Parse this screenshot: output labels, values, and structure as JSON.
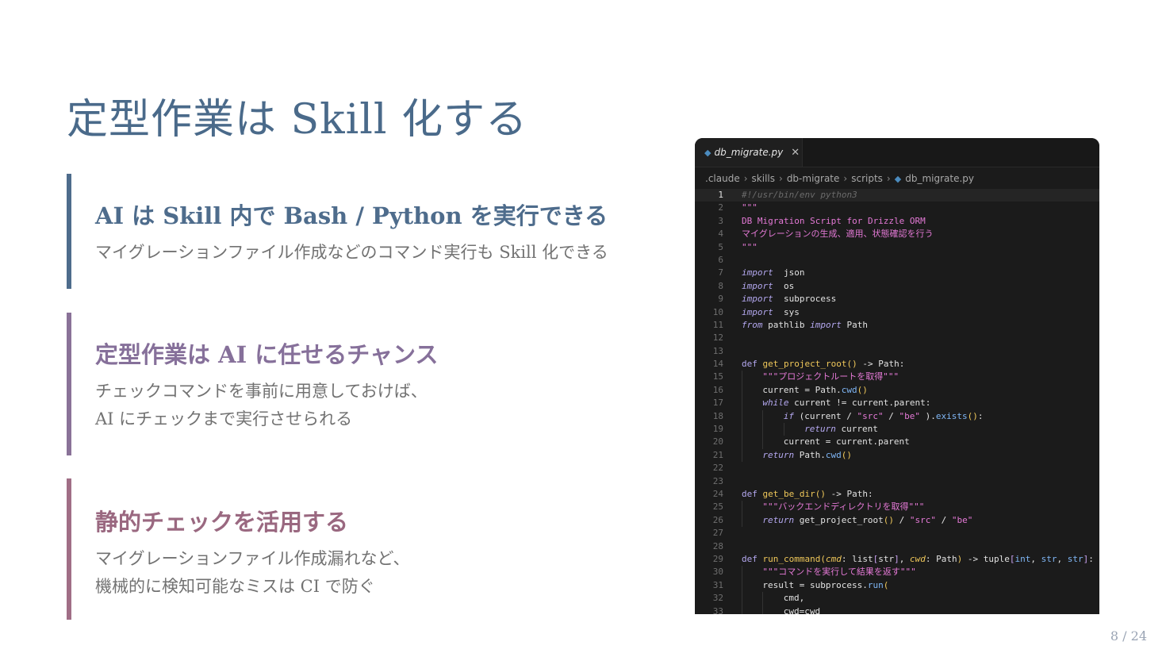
{
  "slide": {
    "title": "定型作業は Skill 化する",
    "points": [
      {
        "heading": "AI は Skill 内で Bash / Python を実行できる",
        "body": [
          "マイグレーションファイル作成などのコマンド実行も Skill 化できる"
        ]
      },
      {
        "heading": "定型作業は AI に任せるチャンス",
        "body": [
          "チェックコマンドを事前に用意しておけば、",
          "AI にチェックまで実行させられる"
        ]
      },
      {
        "heading": "静的チェックを活用する",
        "body": [
          "マイグレーションファイル作成漏れなど、",
          "機械的に検知可能なミスは CI で防ぐ"
        ]
      }
    ],
    "page_number": "8 / 24"
  },
  "editor": {
    "tab": {
      "filename": "db_migrate.py",
      "file_icon": "python-icon",
      "close_icon": "close-icon"
    },
    "breadcrumb": [
      ".claude",
      "skills",
      "db-migrate",
      "scripts",
      "db_migrate.py"
    ],
    "active_line": 1,
    "lines": [
      {
        "n": "1",
        "indent": 0,
        "parts": [
          [
            "c-com",
            "#!/usr/bin/env python3"
          ]
        ]
      },
      {
        "n": "2",
        "indent": 0,
        "parts": [
          [
            "c-str",
            "\"\"\""
          ]
        ]
      },
      {
        "n": "3",
        "indent": 0,
        "parts": [
          [
            "c-str",
            "DB Migration Script for Drizzle ORM"
          ]
        ]
      },
      {
        "n": "4",
        "indent": 0,
        "parts": [
          [
            "c-str",
            "マイグレーションの生成、適用、状態確認を行う"
          ]
        ]
      },
      {
        "n": "5",
        "indent": 0,
        "parts": [
          [
            "c-str",
            "\"\"\""
          ]
        ]
      },
      {
        "n": "6",
        "indent": 0,
        "parts": []
      },
      {
        "n": "7",
        "indent": 0,
        "parts": [
          [
            "c-kw",
            "import"
          ],
          [
            "",
            "  json"
          ]
        ]
      },
      {
        "n": "8",
        "indent": 0,
        "parts": [
          [
            "c-kw",
            "import"
          ],
          [
            "",
            "  os"
          ]
        ]
      },
      {
        "n": "9",
        "indent": 0,
        "parts": [
          [
            "c-kw",
            "import"
          ],
          [
            "",
            "  subprocess"
          ]
        ]
      },
      {
        "n": "10",
        "indent": 0,
        "parts": [
          [
            "c-kw",
            "import"
          ],
          [
            "",
            "  sys"
          ]
        ]
      },
      {
        "n": "11",
        "indent": 0,
        "parts": [
          [
            "c-kw",
            "from"
          ],
          [
            "",
            " pathlib "
          ],
          [
            "c-kw",
            "import"
          ],
          [
            "",
            " Path"
          ]
        ]
      },
      {
        "n": "12",
        "indent": 0,
        "parts": []
      },
      {
        "n": "13",
        "indent": 0,
        "parts": []
      },
      {
        "n": "14",
        "indent": 0,
        "parts": [
          [
            "c-def",
            "def "
          ],
          [
            "c-fn",
            "get_project_root"
          ],
          [
            "c-par",
            "()"
          ],
          [
            "",
            " -> Path:"
          ]
        ]
      },
      {
        "n": "15",
        "indent": 1,
        "parts": [
          [
            "c-str",
            "\"\"\"プロジェクトルートを取得\"\"\""
          ]
        ]
      },
      {
        "n": "16",
        "indent": 1,
        "parts": [
          [
            "",
            "current = Path."
          ],
          [
            "c-call",
            "cwd"
          ],
          [
            "c-par",
            "()"
          ]
        ]
      },
      {
        "n": "17",
        "indent": 1,
        "parts": [
          [
            "c-kw",
            "while"
          ],
          [
            "",
            " current != current.parent:"
          ]
        ]
      },
      {
        "n": "18",
        "indent": 2,
        "parts": [
          [
            "c-kw",
            "if"
          ],
          [
            "",
            " (current / "
          ],
          [
            "c-str",
            "\"src\""
          ],
          [
            "",
            " / "
          ],
          [
            "c-str",
            "\"be\""
          ],
          [
            "",
            " )."
          ],
          [
            "c-call",
            "exists"
          ],
          [
            "c-par",
            "()"
          ],
          [
            "",
            ":"
          ]
        ]
      },
      {
        "n": "19",
        "indent": 3,
        "parts": [
          [
            "c-kw",
            "return"
          ],
          [
            "",
            " current"
          ]
        ]
      },
      {
        "n": "20",
        "indent": 2,
        "parts": [
          [
            "",
            "current = current.parent"
          ]
        ]
      },
      {
        "n": "21",
        "indent": 1,
        "parts": [
          [
            "c-kw",
            "return"
          ],
          [
            "",
            " Path."
          ],
          [
            "c-call",
            "cwd"
          ],
          [
            "c-par",
            "()"
          ]
        ]
      },
      {
        "n": "22",
        "indent": 0,
        "parts": []
      },
      {
        "n": "23",
        "indent": 0,
        "parts": []
      },
      {
        "n": "24",
        "indent": 0,
        "parts": [
          [
            "c-def",
            "def "
          ],
          [
            "c-fn",
            "get_be_dir"
          ],
          [
            "c-par",
            "()"
          ],
          [
            "",
            " -> Path:"
          ]
        ]
      },
      {
        "n": "25",
        "indent": 1,
        "parts": [
          [
            "c-str",
            "\"\"\"バックエンドディレクトリを取得\"\"\""
          ]
        ]
      },
      {
        "n": "26",
        "indent": 1,
        "parts": [
          [
            "c-kw",
            "return"
          ],
          [
            "",
            " get_project_root"
          ],
          [
            "c-par",
            "()"
          ],
          [
            "",
            " / "
          ],
          [
            "c-str",
            "\"src\""
          ],
          [
            "",
            " / "
          ],
          [
            "c-str",
            "\"be\""
          ]
        ]
      },
      {
        "n": "27",
        "indent": 0,
        "parts": []
      },
      {
        "n": "28",
        "indent": 0,
        "parts": []
      },
      {
        "n": "29",
        "indent": 0,
        "parts": [
          [
            "c-def",
            "def "
          ],
          [
            "c-fn",
            "run_command"
          ],
          [
            "c-par",
            "("
          ],
          [
            "c-prm",
            "cmd"
          ],
          [
            "",
            ": list"
          ],
          [
            "c-sq",
            "["
          ],
          [
            "",
            "str"
          ],
          [
            "c-sq",
            "]"
          ],
          [
            "",
            ", "
          ],
          [
            "c-prm",
            "cwd"
          ],
          [
            "",
            ": Path"
          ],
          [
            "c-par",
            ")"
          ],
          [
            "",
            " -> tuple"
          ],
          [
            "c-sq",
            "["
          ],
          [
            "c-typ",
            "int"
          ],
          [
            "",
            ", "
          ],
          [
            "c-typ",
            "str"
          ],
          [
            "",
            ", "
          ],
          [
            "c-typ",
            "str"
          ],
          [
            "c-sq",
            "]"
          ],
          [
            "",
            ":"
          ]
        ]
      },
      {
        "n": "30",
        "indent": 1,
        "parts": [
          [
            "c-str",
            "\"\"\"コマンドを実行して結果を返す\"\"\""
          ]
        ]
      },
      {
        "n": "31",
        "indent": 1,
        "parts": [
          [
            "",
            "result = subprocess."
          ],
          [
            "c-call",
            "run"
          ],
          [
            "c-par",
            "("
          ]
        ]
      },
      {
        "n": "32",
        "indent": 2,
        "parts": [
          [
            "",
            "cmd,"
          ]
        ]
      },
      {
        "n": "33",
        "indent": 2,
        "parts": [
          [
            "",
            "cwd=cwd"
          ]
        ]
      }
    ]
  }
}
